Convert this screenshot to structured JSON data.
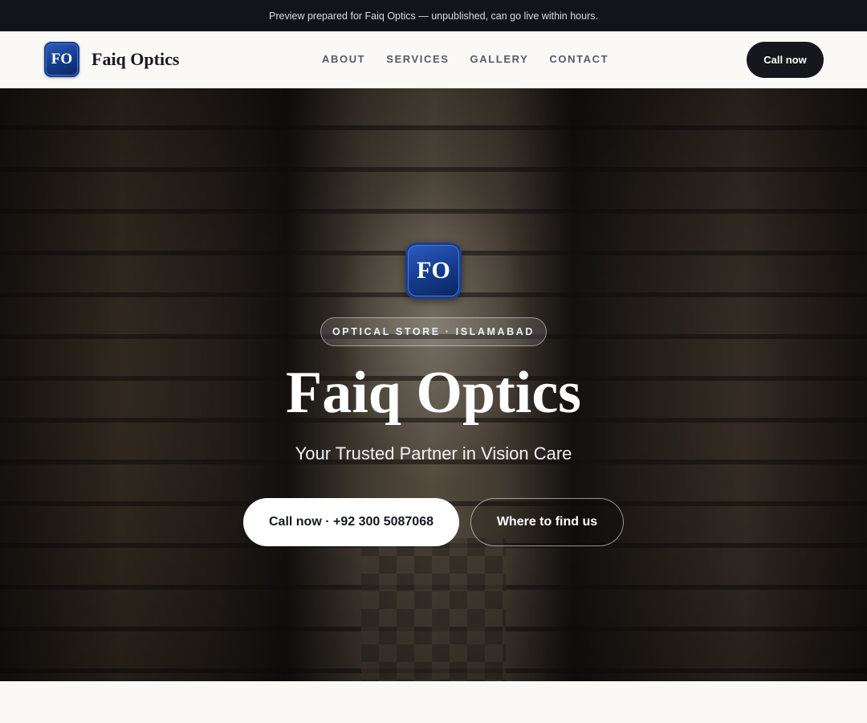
{
  "preview_bar": {
    "text": "Preview prepared for Faiq Optics — unpublished, can go live within hours."
  },
  "header": {
    "logo_text": "FO",
    "brand_name": "Faiq Optics",
    "nav": [
      "ABOUT",
      "SERVICES",
      "GALLERY",
      "CONTACT"
    ],
    "call_button": "Call now"
  },
  "hero": {
    "logo_text": "FO",
    "badge": "OPTICAL STORE · ISLAMABAD",
    "title": "Faiq Optics",
    "subtitle": "Your Trusted Partner in Vision Care",
    "primary_button": "Call now · +92 300 5087068",
    "secondary_button": "Where to find us"
  },
  "colors": {
    "dark": "#15171c",
    "logo_blue": "#133a8a",
    "page_background": "#faf9f6"
  },
  "icons": {
    "brand_logo": "fo-monogram-icon"
  }
}
